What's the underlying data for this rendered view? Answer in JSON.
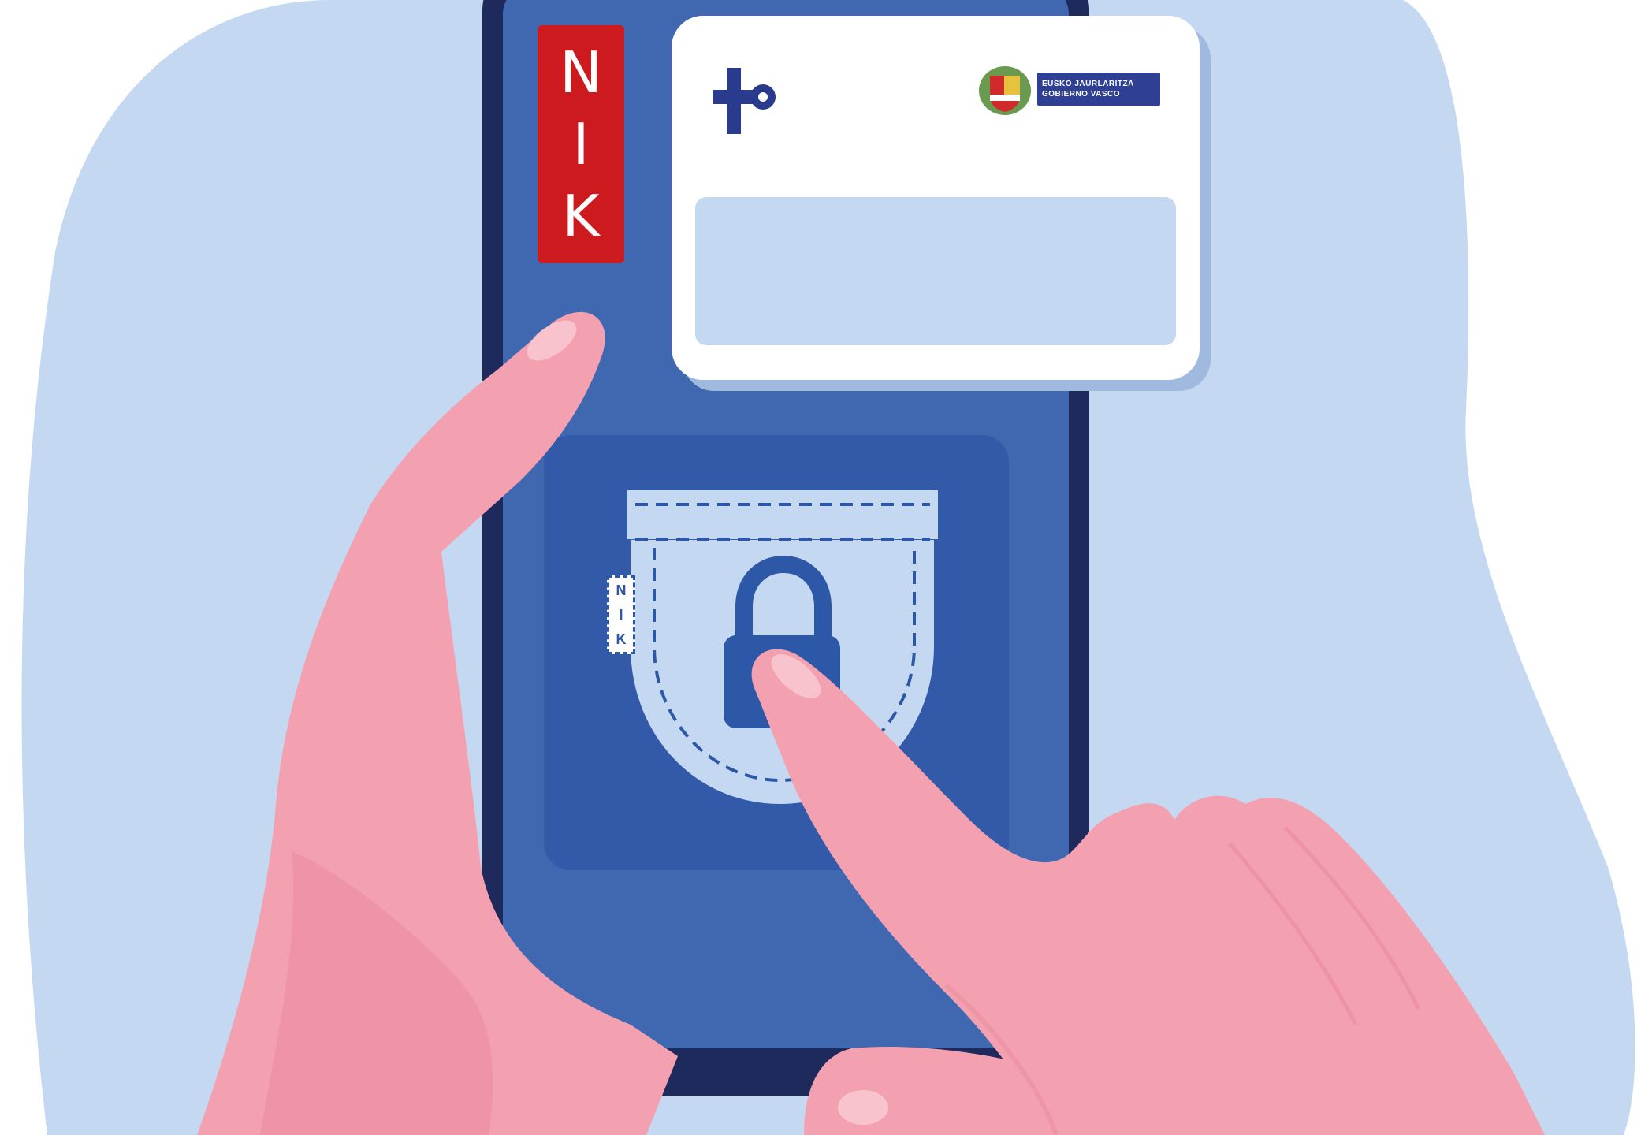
{
  "nik_tab": {
    "letters": [
      "N",
      "I",
      "K"
    ]
  },
  "pocket_tag": {
    "letters": [
      "N",
      "I",
      "K"
    ]
  },
  "gov_logo": {
    "line1": "Eusko Jaurlaritza",
    "line2": "Gobierno Vasco"
  },
  "colors": {
    "background_blob": "#c4d9f1",
    "phone_frame": "#1f2a5c",
    "phone_screen": "#3f68b1",
    "inner_panel": "#335aa8",
    "nik_red": "#cc1a1f",
    "skin": "#f3a1b1",
    "skin_shadow": "#ea8a9c",
    "pocket": "#c4d9f1",
    "lock": "#2d58a8"
  },
  "icons": [
    "osakidetza-icon",
    "lock-icon",
    "pocket-icon",
    "coat-of-arms-icon"
  ]
}
